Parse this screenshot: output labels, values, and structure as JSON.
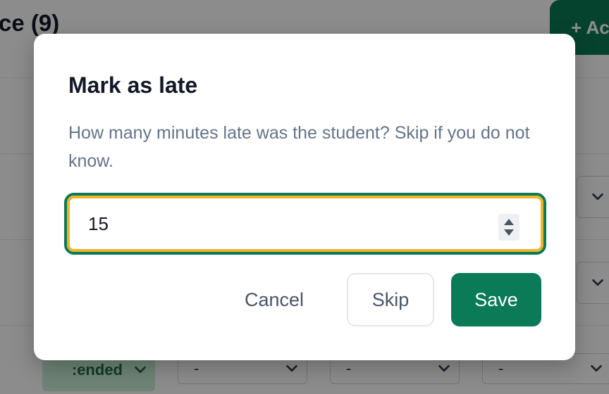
{
  "page": {
    "title_fragment": "ce (9)",
    "add_button_label": "+ Ac",
    "row_status_fragment": ":ended",
    "select_placeholder": "-"
  },
  "dialog": {
    "title": "Mark as late",
    "description": "How many minutes late was the student? Skip if you do not know.",
    "minutes_value": "15",
    "cancel_label": "Cancel",
    "skip_label": "Skip",
    "save_label": "Save"
  },
  "colors": {
    "primary": "#0b7a57",
    "focus_ring": "#f0b429",
    "status_bg": "#c9f0d8"
  }
}
